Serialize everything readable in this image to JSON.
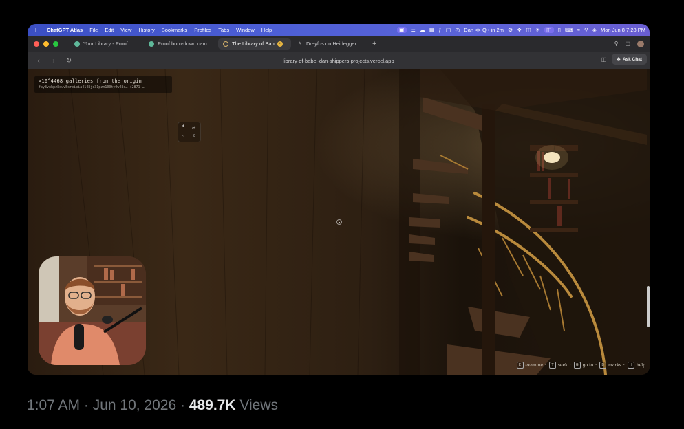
{
  "menubar": {
    "app_name": "ChatGPT Atlas",
    "items": [
      "File",
      "Edit",
      "View",
      "History",
      "Bookmarks",
      "Profiles",
      "Tabs",
      "Window",
      "Help"
    ],
    "meeting": "Dan <> Q • in 2m",
    "datetime": "Mon Jun 8  7:28 PM"
  },
  "tabs": [
    {
      "title": "Your Library - Proof",
      "active": false
    },
    {
      "title": "Proof burn-down cam",
      "active": false
    },
    {
      "title": "The Library of Bab",
      "active": true
    },
    {
      "title": "Dreyfus on Heidegger",
      "active": false
    }
  ],
  "address": {
    "url": "library-of-babel-dan-shippers-projects.vercel.app",
    "ask_chat": "Ask Chat"
  },
  "scene": {
    "coords_title": "≈10^4468 galleries from the origin",
    "coords_hash": "fpy3vxhpz8ouv5sreipia4148jc31pzn100ty0w48o… (2871 …",
    "glyphs": [
      "ᵈ",
      "ə"
    ],
    "glyph_keys": [
      "‹",
      "8"
    ],
    "hints": [
      {
        "key": "E",
        "label": "examine"
      },
      {
        "key": "T",
        "label": "seek"
      },
      {
        "key": "G",
        "label": "go to"
      },
      {
        "key": "B",
        "label": "marks"
      },
      {
        "key": "H",
        "label": "help"
      }
    ]
  },
  "tweet": {
    "timestamp": "1:07 AM · Jun 10, 2026 · ",
    "views_count": "489.7K",
    "views_label": " Views"
  }
}
